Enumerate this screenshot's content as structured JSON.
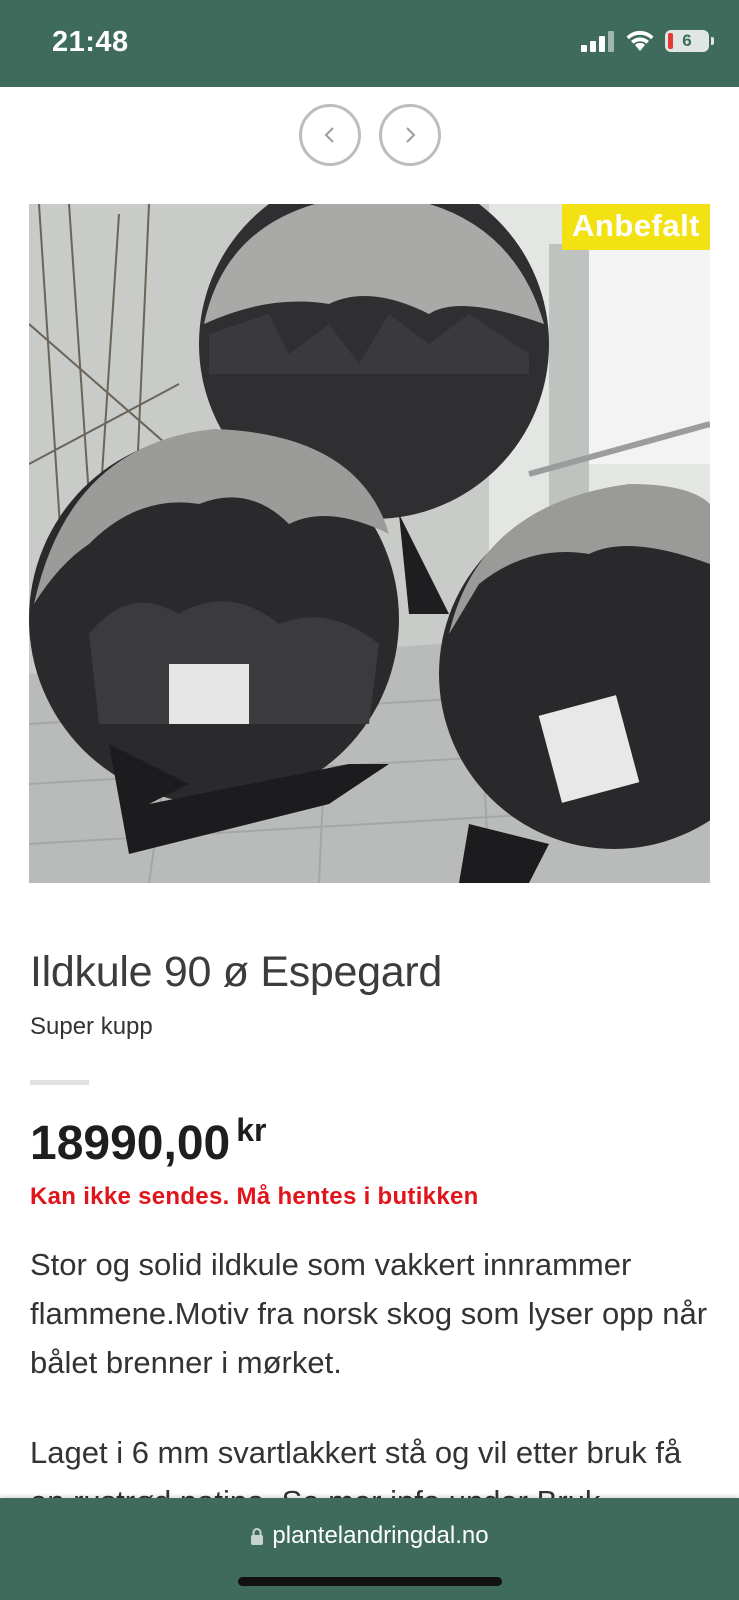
{
  "status_bar": {
    "time": "21:48",
    "battery_level": "6",
    "icons": [
      "signal-icon",
      "wifi-icon",
      "battery-icon"
    ]
  },
  "carousel": {
    "prev_icon": "chevron-left-icon",
    "next_icon": "chevron-right-icon"
  },
  "product": {
    "badge": "Anbefalt",
    "title": "Ildkule 90 ø Espegard",
    "subtitle": "Super kupp",
    "price": "18990,00",
    "currency": "kr",
    "shipping_notice": "Kan ikke sendes. Må hentes i butikken",
    "description_1": "Stor og solid ildkule som vakkert innrammer flammene.Motiv fra norsk skog som lyser opp når bålet brenner i mørket.",
    "description_2": "Laget i 6 mm svartlakkert stå og vil etter bruk få en rustrød patina. Se mer info under Bruk"
  },
  "browser": {
    "url": "plantelandringdal.no"
  },
  "colors": {
    "brand_green": "#3f6b5c",
    "badge_yellow": "#f2e214",
    "notice_red": "#e0141a"
  }
}
